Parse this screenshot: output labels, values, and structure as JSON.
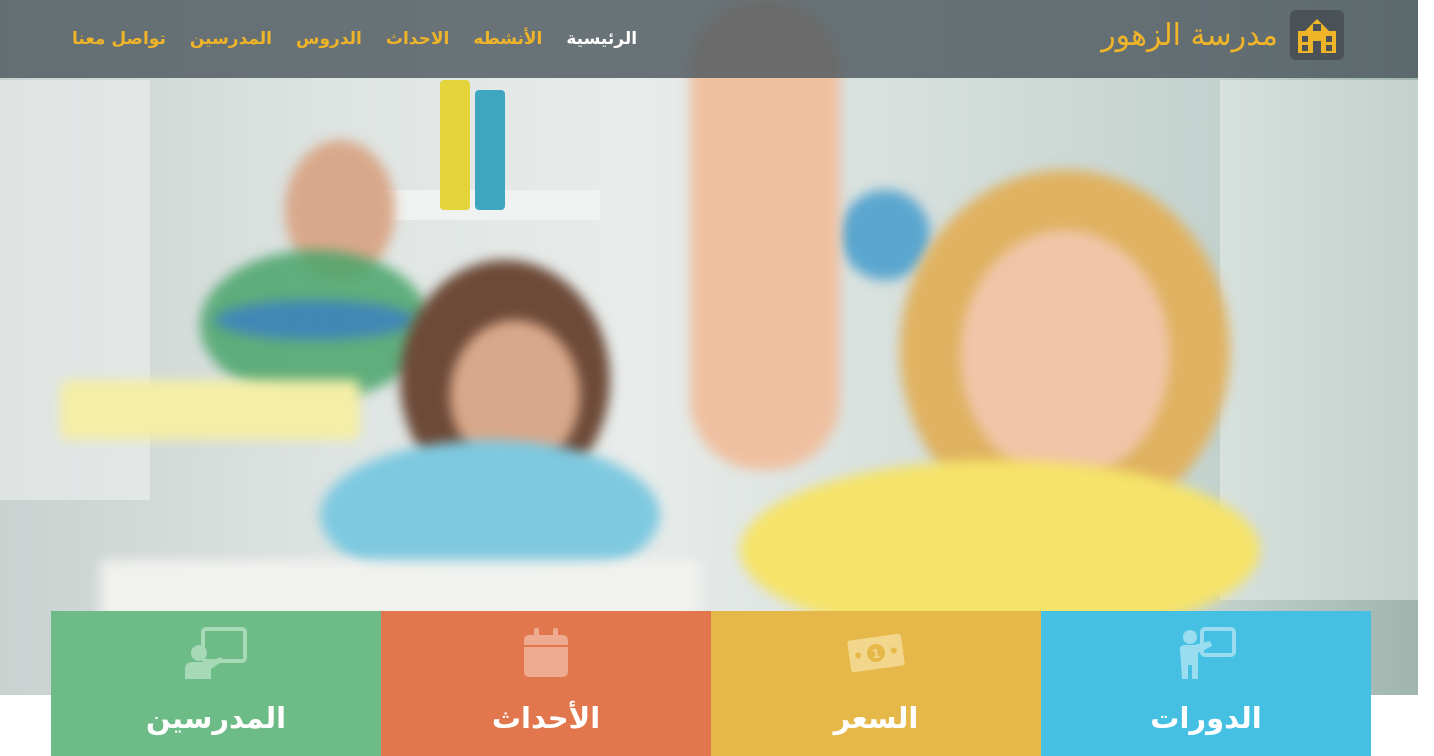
{
  "brand": {
    "name": "مدرسة الزهور",
    "logo_icon": "school-building-icon"
  },
  "nav": {
    "items": [
      {
        "label": "الرئيسية",
        "active": true
      },
      {
        "label": "الأنشطه",
        "active": false
      },
      {
        "label": "الاحداث",
        "active": false
      },
      {
        "label": "الدروس",
        "active": false
      },
      {
        "label": "المدرسين",
        "active": false
      },
      {
        "label": "تواصل معنا",
        "active": false
      }
    ]
  },
  "hero": {
    "image": "students-classroom-photo"
  },
  "tiles": [
    {
      "label": "الدورات",
      "icon": "teacher-board-icon",
      "color": "#45c0e3"
    },
    {
      "label": "السعر",
      "icon": "money-bill-icon",
      "color": "#e6b84a"
    },
    {
      "label": "الأحداث",
      "icon": "calendar-icon",
      "color": "#e2774d"
    },
    {
      "label": "المدرسين",
      "icon": "presenter-icon",
      "color": "#6dbb87"
    }
  ],
  "colors": {
    "accent": "#f0b429",
    "navbar": "#4d585e"
  }
}
